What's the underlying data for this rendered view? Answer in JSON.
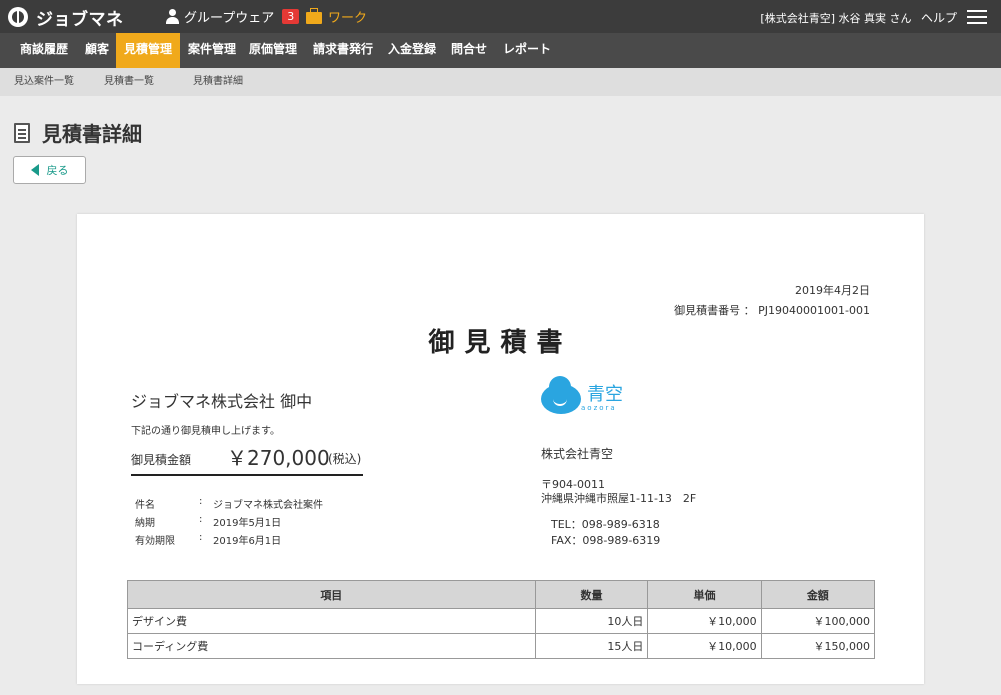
{
  "app": {
    "name": "ジョブマネ"
  },
  "topbar": {
    "groupware_label": "グループウェア",
    "groupware_count": "3",
    "work_label": "ワーク",
    "company_user": "[株式会社青空] 水谷 真実 さん",
    "help_label": "ヘルプ"
  },
  "nav": {
    "items": [
      "商談履歴",
      "顧客",
      "見積管理",
      "案件管理",
      "原価管理",
      "請求書発行",
      "入金登録",
      "問合せ",
      "レポート"
    ],
    "active": "見積管理"
  },
  "breadcrumb": [
    "見込案件一覧",
    "見積書一覧",
    "見積書詳細"
  ],
  "page": {
    "title": "見積書詳細",
    "back_label": "戻る"
  },
  "quote": {
    "date": "2019年4月2日",
    "number_label": "御見積書番号 ：",
    "number": "PJ19040001001-001",
    "title": "御見積書",
    "client": "ジョブマネ株式会社 御中",
    "intro": "下記の通り御見積申し上げます。",
    "amount_label": "御見積金額",
    "amount_value": "￥270,000",
    "amount_tax": "(税込)",
    "fields": [
      {
        "key": "件名",
        "value": "ジョブマネ株式会社案件"
      },
      {
        "key": "納期",
        "value": "2019年5月1日"
      },
      {
        "key": "有効期限",
        "value": "2019年6月1日"
      }
    ],
    "company": {
      "logo_name": "青空",
      "logo_sub": "aozora",
      "name": "株式会社青空",
      "zip": "〒904-0011",
      "address": "沖縄県沖縄市照屋1-11-13　2F",
      "tel": "TEL：098-989-6318",
      "fax": "FAX：098-989-6319"
    },
    "table": {
      "headers": [
        "項目",
        "数量",
        "単価",
        "金額"
      ],
      "rows": [
        [
          "デザイン費",
          "10人日",
          "￥10,000",
          "￥100,000"
        ],
        [
          "コーディング費",
          "15人日",
          "￥10,000",
          "￥150,000"
        ]
      ]
    }
  },
  "colors": {
    "accent": "#f0a91b",
    "topbar": "#3c3c3c",
    "badge": "#e53935",
    "teal": "#1a9a8a",
    "logo_blue": "#2aa5e0"
  }
}
